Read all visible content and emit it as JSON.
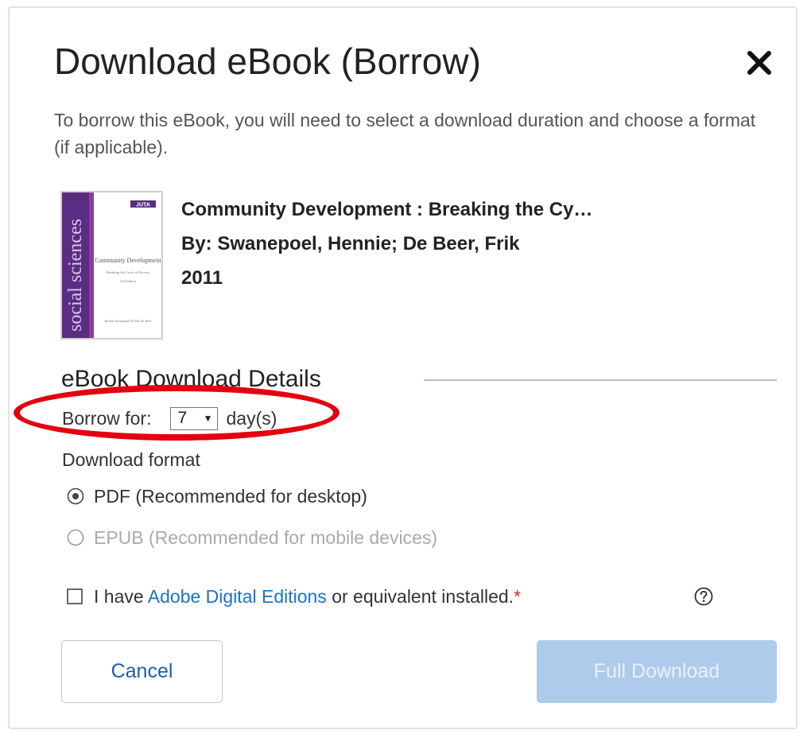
{
  "dialog": {
    "title": "Download eBook (Borrow)",
    "close_icon": "close-icon",
    "intro": "To borrow this eBook, you will need to select a download duration and choose a format (if applicable)."
  },
  "book": {
    "title": "Community Development : Breaking the Cy…",
    "authors": "By: Swanepoel, Hennie; De Beer, Frik",
    "year": "2011",
    "cover": {
      "spine_text": "social sciences",
      "publisher_badge": "JUTA",
      "cover_title": "Community Development",
      "cover_subtitle": "Breaking the Cycle of Poverty",
      "edition": "5th Edition",
      "cover_authors": "Hennie Swanepoel & Frik De Beer"
    }
  },
  "details": {
    "section_title": "eBook Download Details",
    "borrow_label": "Borrow for:",
    "borrow_value": "7",
    "borrow_unit": "day(s)",
    "format_label": "Download format",
    "formats": [
      {
        "label": "PDF (Recommended for desktop)",
        "selected": true,
        "enabled": true
      },
      {
        "label": "EPUB (Recommended for mobile devices)",
        "selected": false,
        "enabled": false
      }
    ],
    "confirm": {
      "prefix": "I have ",
      "link": "Adobe Digital Editions",
      "suffix": " or equivalent installed.",
      "required_mark": "*",
      "checked": false
    },
    "help_icon": "question-circle-icon"
  },
  "buttons": {
    "cancel": "Cancel",
    "download": "Full Download"
  },
  "colors": {
    "link": "#1a73c8",
    "primary_disabled": "#aecbeb",
    "annotation": "#e3000f",
    "cover_purple": "#5a2d82"
  }
}
